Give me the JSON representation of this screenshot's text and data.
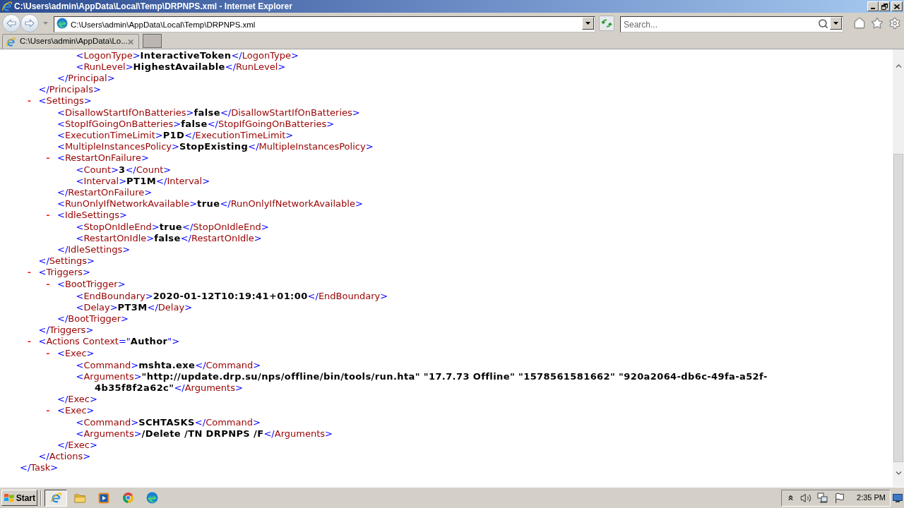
{
  "window": {
    "title": "C:\\Users\\admin\\AppData\\Local\\Temp\\DRPNPS.xml - Internet Explorer"
  },
  "navigation": {
    "address": "C:\\Users\\admin\\AppData\\Local\\Temp\\DRPNPS.xml",
    "search": {
      "placeholder": "Search..."
    }
  },
  "tabs": [
    {
      "label": "C:\\Users\\admin\\AppData\\Lo...",
      "selected": true
    }
  ],
  "document": {
    "close_tag": "</Task>",
    "children": [
      {
        "close_tag": "</Principals>",
        "children": [
          {
            "close_tag": "</Principal>",
            "children": [
              {
                "open_tag": "<LogonType>",
                "value": "InteractiveToken",
                "close_tag": "</LogonType>"
              },
              {
                "open_tag": "<RunLevel>",
                "value": "HighestAvailable",
                "close_tag": "</RunLevel>"
              }
            ]
          }
        ]
      },
      {
        "toggle": "-",
        "open_tag": "<Settings>",
        "children": [
          {
            "open_tag": "<DisallowStartIfOnBatteries>",
            "value": "false",
            "close_tag": "</DisallowStartIfOnBatteries>"
          },
          {
            "open_tag": "<StopIfGoingOnBatteries>",
            "value": "false",
            "close_tag": "</StopIfGoingOnBatteries>"
          },
          {
            "open_tag": "<ExecutionTimeLimit>",
            "value": "P1D",
            "close_tag": "</ExecutionTimeLimit>"
          },
          {
            "open_tag": "<MultipleInstancesPolicy>",
            "value": "StopExisting",
            "close_tag": "</MultipleInstancesPolicy>"
          },
          {
            "toggle": "-",
            "open_tag": "<RestartOnFailure>",
            "children": [
              {
                "open_tag": "<Count>",
                "value": "3",
                "close_tag": "</Count>"
              },
              {
                "open_tag": "<Interval>",
                "value": "PT1M",
                "close_tag": "</Interval>"
              }
            ],
            "close_tag": "</RestartOnFailure>"
          },
          {
            "open_tag": "<RunOnlyIfNetworkAvailable>",
            "value": "true",
            "close_tag": "</RunOnlyIfNetworkAvailable>"
          },
          {
            "toggle": "-",
            "open_tag": "<IdleSettings>",
            "children": [
              {
                "open_tag": "<StopOnIdleEnd>",
                "value": "true",
                "close_tag": "</StopOnIdleEnd>"
              },
              {
                "open_tag": "<RestartOnIdle>",
                "value": "false",
                "close_tag": "</RestartOnIdle>"
              }
            ],
            "close_tag": "</IdleSettings>"
          }
        ],
        "close_tag": "</Settings>"
      },
      {
        "toggle": "-",
        "open_tag": "<Triggers>",
        "children": [
          {
            "toggle": "-",
            "open_tag": "<BootTrigger>",
            "children": [
              {
                "open_tag": "<EndBoundary>",
                "value": "2020-01-12T10:19:41+01:00",
                "close_tag": "</EndBoundary>"
              },
              {
                "open_tag": "<Delay>",
                "value": "PT3M",
                "close_tag": "</Delay>"
              }
            ],
            "close_tag": "</BootTrigger>"
          }
        ],
        "close_tag": "</Triggers>"
      },
      {
        "toggle": "-",
        "open_tag": "<Actions Context=\"Author\">",
        "children": [
          {
            "toggle": "-",
            "open_tag": "<Exec>",
            "children": [
              {
                "open_tag": "<Command>",
                "value": "mshta.exe",
                "close_tag": "</Command>"
              },
              {
                "open_tag": "<Arguments>",
                "value": "\"http://update.drp.su/nps/offline/bin/tools/run.hta\" \"17.7.73 Offline\" \"1578561581662\" \"920a2064-db6c-49fa-a52f-4b35f8f2a62c\"",
                "close_tag": "</Arguments>"
              }
            ],
            "close_tag": "</Exec>"
          },
          {
            "toggle": "-",
            "open_tag": "<Exec>",
            "children": [
              {
                "open_tag": "<Command>",
                "value": "SCHTASKS",
                "close_tag": "</Command>"
              },
              {
                "open_tag": "<Arguments>",
                "value": "/Delete /TN DRPNPS /F",
                "close_tag": "</Arguments>"
              }
            ],
            "close_tag": "</Exec>"
          }
        ],
        "close_tag": "</Actions>"
      }
    ]
  },
  "taskbar": {
    "start": "Start",
    "apps": [
      {
        "selected": true
      },
      {
        "selected": false
      },
      {
        "selected": false
      },
      {
        "selected": false
      },
      {
        "selected": false
      }
    ],
    "clock": "2:35 PM"
  }
}
